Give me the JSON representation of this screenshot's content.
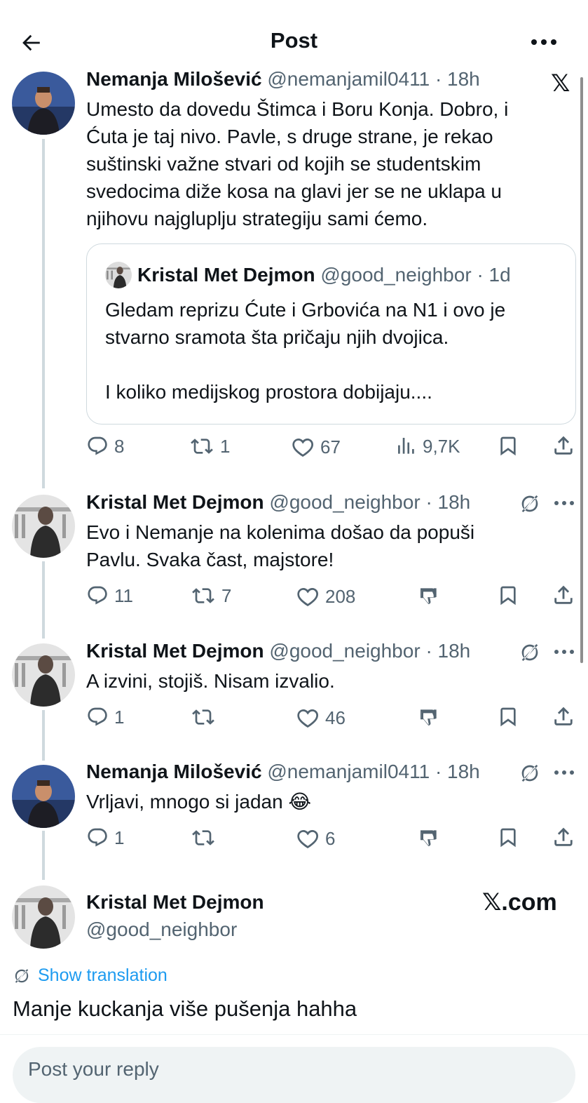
{
  "header": {
    "title": "Post",
    "back_icon": "arrow-left-icon",
    "more_icon": "more-horizontal-icon"
  },
  "watermark": {
    "x_logo": "𝕏",
    "xcom": "𝕏.com"
  },
  "posts": [
    {
      "name": "Nemanja Milošević",
      "handle": "@nemanjamil0411",
      "time": "· 18h",
      "lines": [
        "Umesto da dovedu Štimca i Boru Konja. Dobro, i",
        "Ćuta je taj nivo. Pavle, s druge strane, je rekao",
        "suštinski važne stvari od kojih se studentskim",
        "svedocima diže kosa na glavi jer se ne uklapa u",
        "njihovu najgluplju strategiju sami ćemo."
      ],
      "quote": {
        "name": "Kristal Met Dejmon",
        "handle": "@good_neighbor",
        "time": "· 1d",
        "lines": [
          "Gledam reprizu Ćute i Grbovića na N1 i ovo je",
          "stvarno sramota šta pričaju njih dvojica.",
          "",
          "I koliko medijskog prostora dobijaju...."
        ]
      },
      "actions": {
        "replies": "8",
        "reposts": "1",
        "likes": "67",
        "views": "9,7K"
      }
    },
    {
      "name": "Kristal Met Dejmon",
      "handle": "@good_neighbor",
      "time": "· 18h",
      "lines": [
        "Evo i Nemanje na kolenima došao da popuši",
        "Pavlu. Svaka čast, majstore!"
      ],
      "actions": {
        "replies": "11",
        "reposts": "7",
        "likes": "208"
      }
    },
    {
      "name": "Kristal Met Dejmon",
      "handle": "@good_neighbor",
      "time": "· 18h",
      "lines": [
        "A izvini, stojiš. Nisam izvalio."
      ],
      "actions": {
        "replies": "1",
        "reposts": "",
        "likes": "46"
      }
    },
    {
      "name": "Nemanja Milošević",
      "handle": "@nemanjamil0411",
      "time": "· 18h",
      "lines": [
        "Vrljavi, mnogo si jadan 😂"
      ],
      "actions": {
        "replies": "1",
        "reposts": "",
        "likes": "6"
      }
    }
  ],
  "focused": {
    "name": "Kristal Met Dejmon",
    "handle": "@good_neighbor",
    "show_translation": "Show translation",
    "text": "Manje kuckanja više pušenja hahha"
  },
  "reply": {
    "placeholder": "Post your reply"
  },
  "colors": {
    "text": "#0f1419",
    "secondary": "#536471",
    "link": "#1d9bf0",
    "border": "#cfd9de",
    "reply_bg": "#eff3f4"
  }
}
